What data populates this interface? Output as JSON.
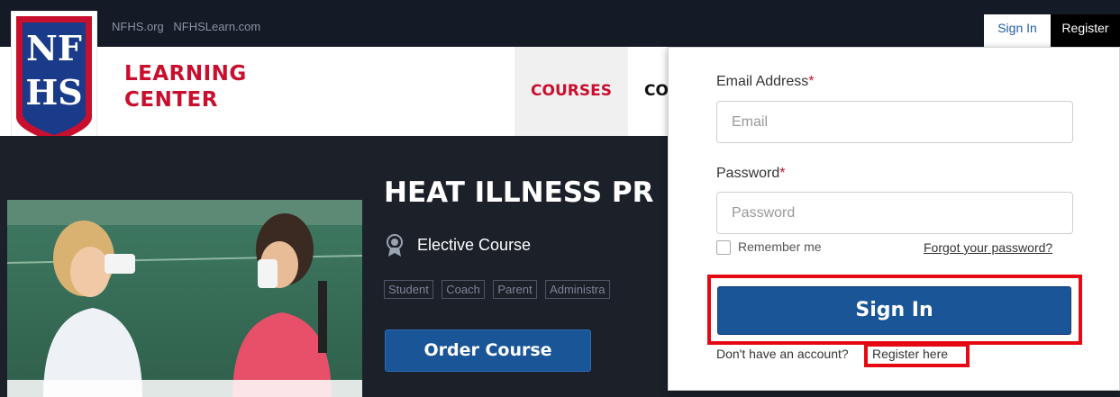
{
  "topbar": {
    "links": [
      "NFHS.org",
      "NFHSLearn.com"
    ],
    "sign_in": "Sign In",
    "register": "Register"
  },
  "logo": {
    "letters_top": "NF",
    "letters_bottom": "HS",
    "brand_line1": "LEARNING",
    "brand_line2": "CENTER",
    "colors": {
      "red": "#c8102e",
      "blue": "#1a3a8a"
    }
  },
  "nav": {
    "items": [
      "COURSES",
      "CO"
    ]
  },
  "course": {
    "title": "HEAT ILLNESS PR",
    "type": "Elective Course",
    "type_icon": "award-ribbon-icon",
    "audiences": [
      "Student",
      "Coach",
      "Parent",
      "Administra"
    ],
    "order_button": "Order Course"
  },
  "signin_panel": {
    "email_label": "Email Address",
    "email_required": "*",
    "email_placeholder": "Email",
    "password_label": "Password",
    "password_required": "*",
    "password_placeholder": "Password",
    "remember_me": "Remember me",
    "remember_checked": false,
    "forgot_password": "Forgot your password?",
    "signin_button": "Sign In",
    "no_account": "Don't have an account?",
    "register_here": "Register here"
  },
  "colors": {
    "accent_blue": "#1a5597",
    "brand_red": "#c8102e",
    "highlight_red": "#e50914",
    "dark_bg": "#1b2029"
  }
}
